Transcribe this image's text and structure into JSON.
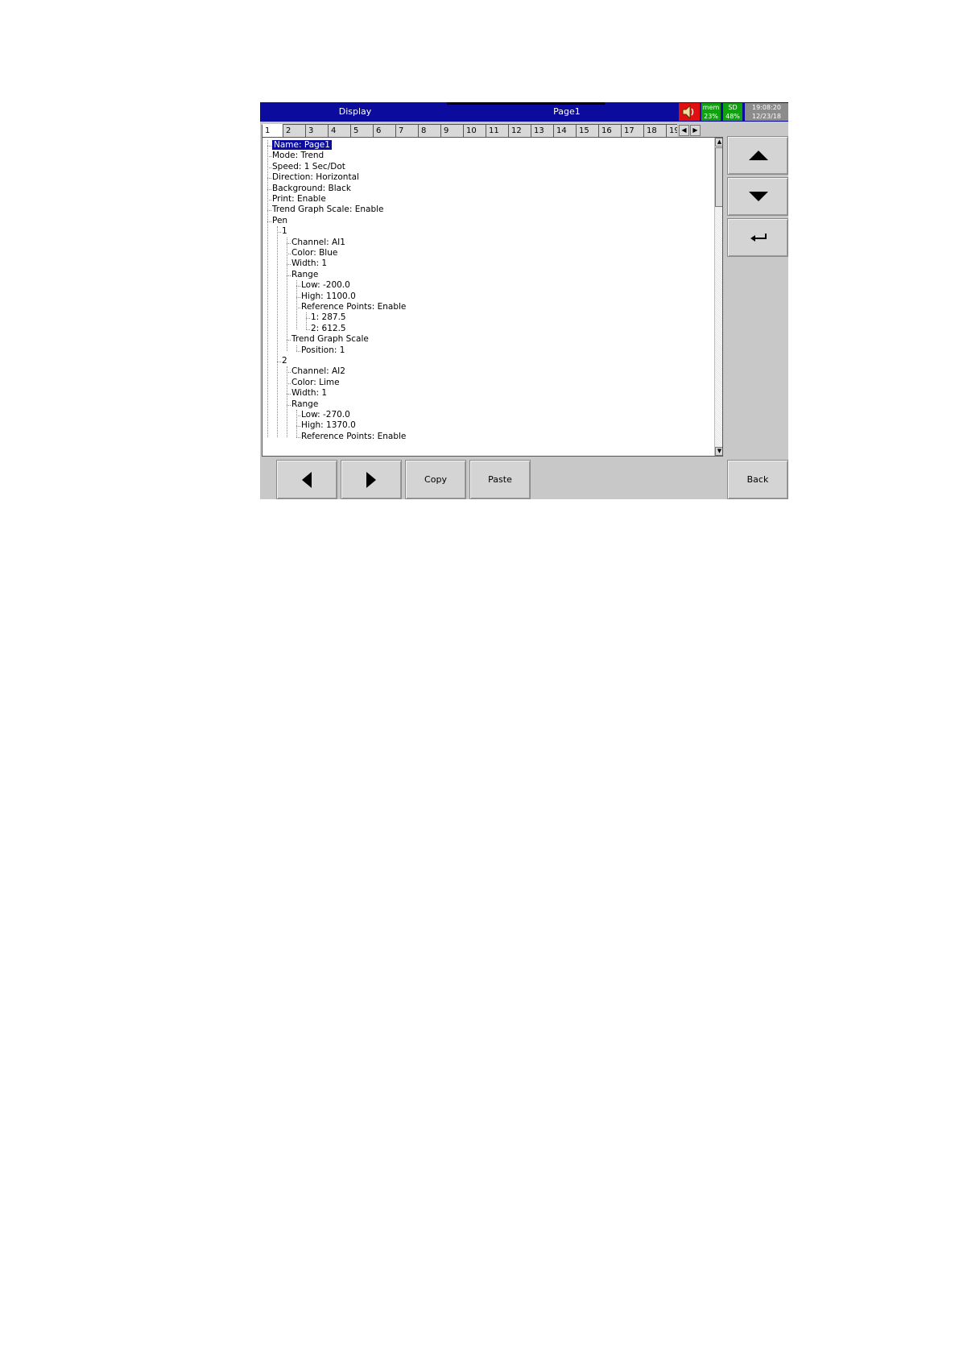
{
  "title_bar": {
    "menu": "Display",
    "page": "Page1",
    "mem_label": "mem",
    "mem_value": "23%",
    "sd_label": "SD",
    "sd_value": "48%",
    "time": "19:08:20",
    "date": "12/23/18",
    "speaker_icon": "speaker-icon"
  },
  "tabs": [
    "1",
    "2",
    "3",
    "4",
    "5",
    "6",
    "7",
    "8",
    "9",
    "10",
    "11",
    "12",
    "13",
    "14",
    "15",
    "16",
    "17",
    "18",
    "19"
  ],
  "active_tab": "1",
  "tree": [
    {
      "text": "Name: Page1",
      "selected": true
    },
    {
      "text": "Mode: Trend"
    },
    {
      "text": "Speed: 1 Sec/Dot"
    },
    {
      "text": "Direction: Horizontal"
    },
    {
      "text": "Background: Black"
    },
    {
      "text": "Print: Enable"
    },
    {
      "text": "Trend Graph Scale: Enable"
    },
    {
      "text": "Pen"
    },
    {
      "text": "1"
    },
    {
      "text": "Channel: AI1"
    },
    {
      "text": "Color: Blue"
    },
    {
      "text": "Width: 1"
    },
    {
      "text": "Range"
    },
    {
      "text": "Low: -200.0"
    },
    {
      "text": "High: 1100.0"
    },
    {
      "text": "Reference Points: Enable"
    },
    {
      "text": "1: 287.5"
    },
    {
      "text": "2: 612.5"
    },
    {
      "text": "Trend Graph Scale"
    },
    {
      "text": "Position: 1"
    },
    {
      "text": "2"
    },
    {
      "text": "Channel: AI2"
    },
    {
      "text": "Color: Lime"
    },
    {
      "text": "Width: 1"
    },
    {
      "text": "Range"
    },
    {
      "text": "Low: -270.0"
    },
    {
      "text": "High: 1370.0"
    },
    {
      "text": "Reference Points: Enable"
    }
  ],
  "buttons": {
    "copy": "Copy",
    "paste": "Paste",
    "back": "Back"
  },
  "colors": {
    "title_bar": "#0b0b9e",
    "alarm": "#e01010",
    "status_ok": "#10a010",
    "panel": "#c8c8c8"
  }
}
